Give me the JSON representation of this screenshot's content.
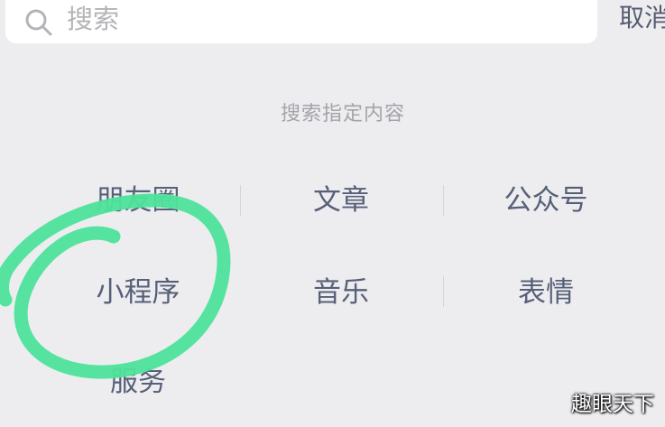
{
  "search": {
    "placeholder": "搜索",
    "cancel_label": "取消",
    "icon": "search-icon"
  },
  "section": {
    "title": "搜索指定内容"
  },
  "categories": [
    {
      "label": "朋友圈"
    },
    {
      "label": "文章"
    },
    {
      "label": "公众号"
    },
    {
      "label": "小程序"
    },
    {
      "label": "音乐"
    },
    {
      "label": "表情"
    },
    {
      "label": "服务"
    }
  ],
  "watermark": {
    "text": "趣眼天下"
  },
  "colors": {
    "background": "#ededf0",
    "item_text": "#576078",
    "annotation": "#4ee39a"
  }
}
